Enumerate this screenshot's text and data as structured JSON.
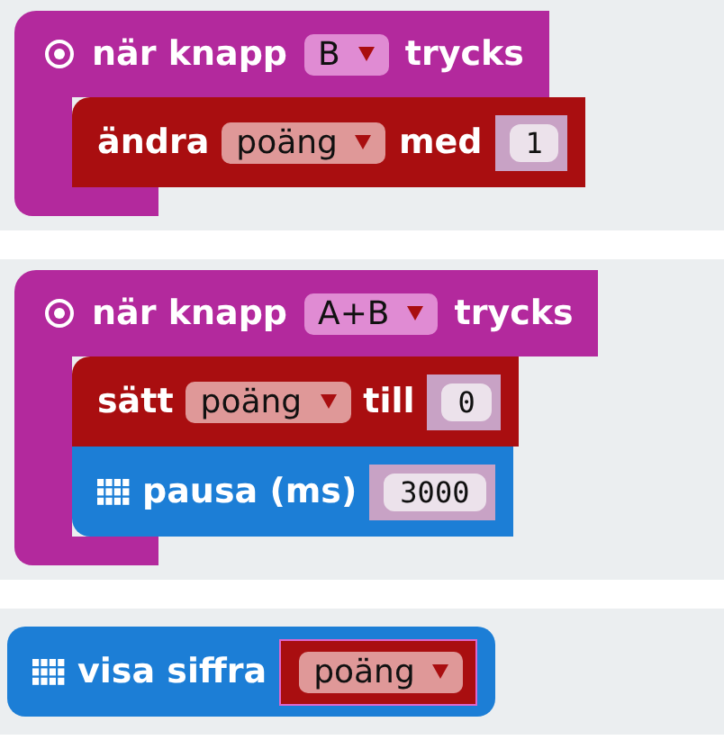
{
  "scripts": [
    {
      "kind": "event",
      "parts": [
        {
          "kind": "text",
          "text": "när knapp"
        },
        {
          "kind": "dropdown",
          "text": "B"
        },
        {
          "kind": "text",
          "text": "trycks"
        }
      ],
      "body": [
        {
          "kind": "variables",
          "parts": [
            {
              "kind": "text",
              "text": "ändra"
            },
            {
              "kind": "dropdown",
              "text": "poäng"
            },
            {
              "kind": "text",
              "text": "med"
            },
            {
              "kind": "number",
              "text": "1"
            }
          ]
        }
      ]
    },
    {
      "kind": "event",
      "parts": [
        {
          "kind": "text",
          "text": "när knapp"
        },
        {
          "kind": "dropdown",
          "text": "A+B"
        },
        {
          "kind": "text",
          "text": "trycks"
        }
      ],
      "body": [
        {
          "kind": "variables",
          "parts": [
            {
              "kind": "text",
              "text": "sätt"
            },
            {
              "kind": "dropdown",
              "text": "poäng"
            },
            {
              "kind": "text",
              "text": "till"
            },
            {
              "kind": "number",
              "text": "0"
            }
          ]
        },
        {
          "kind": "basic",
          "parts": [
            {
              "kind": "text",
              "text": "pausa (ms)"
            },
            {
              "kind": "number",
              "text": "3000"
            }
          ]
        }
      ]
    },
    {
      "kind": "basic",
      "parts": [
        {
          "kind": "text",
          "text": "visa siffra"
        },
        {
          "kind": "variable",
          "text": "poäng"
        }
      ]
    }
  ]
}
